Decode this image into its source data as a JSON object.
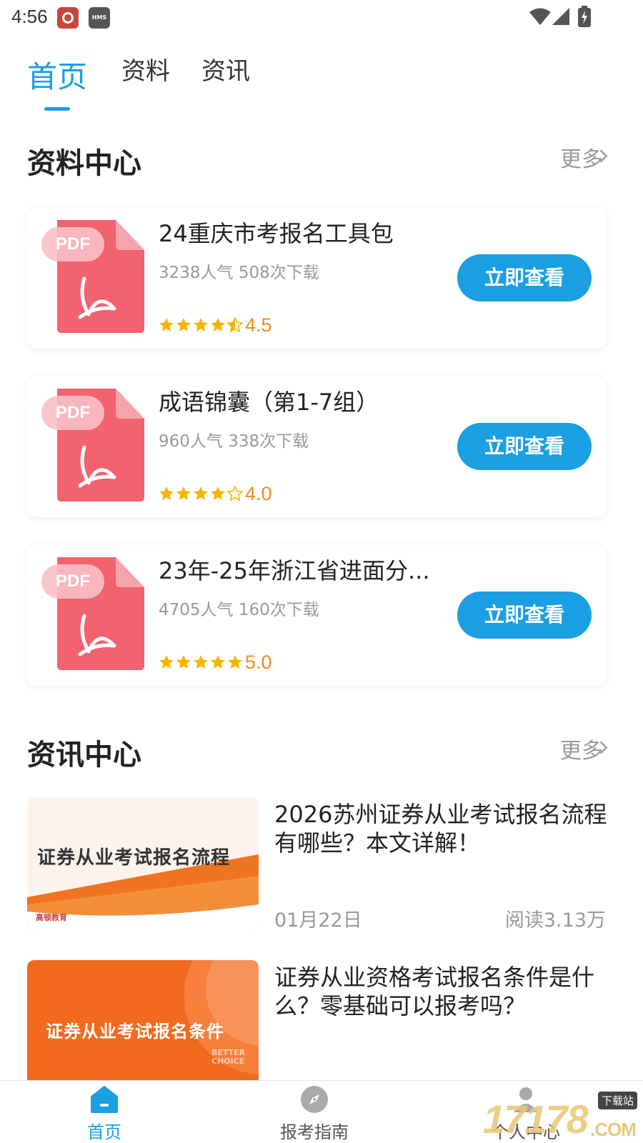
{
  "status_bar": {
    "time": "4:56",
    "app_badge_2": "HMS"
  },
  "top_tabs": [
    {
      "label": "首页",
      "active": true
    },
    {
      "label": "资料",
      "active": false
    },
    {
      "label": "资讯",
      "active": false
    }
  ],
  "resource_center": {
    "title": "资料中心",
    "more_label": "更多",
    "items": [
      {
        "icon_label": "PDF",
        "title": "24重庆市考报名工具包",
        "stats": "3238人气 508次下载",
        "rating": 4.5,
        "rating_text": "4.5",
        "button_label": "立即查看"
      },
      {
        "icon_label": "PDF",
        "title": "成语锦囊（第1-7组）",
        "stats": "960人气 338次下载",
        "rating": 4.0,
        "rating_text": "4.0",
        "button_label": "立即查看"
      },
      {
        "icon_label": "PDF",
        "title": "23年-25年浙江省进面分...",
        "stats": "4705人气 160次下载",
        "rating": 5.0,
        "rating_text": "5.0",
        "button_label": "立即查看"
      }
    ]
  },
  "news_center": {
    "title": "资讯中心",
    "more_label": "更多",
    "items": [
      {
        "thumb_text": "证券从业考试报名流程",
        "thumb_brand": "高顿教育",
        "title": "2026苏州证券从业考试报名流程有哪些？本文详解！",
        "date": "01月22日",
        "reads": "阅读3.13万"
      },
      {
        "thumb_text": "证券从业考试报名条件",
        "thumb_brand": "BETTER CHOICE",
        "title": "证券从业资格考试报名条件是什么？零基础可以报考吗？",
        "date": "",
        "reads": ""
      }
    ]
  },
  "bottom_nav": [
    {
      "label": "首页",
      "icon": "home-icon",
      "active": true
    },
    {
      "label": "报考指南",
      "icon": "compass-icon",
      "active": false
    },
    {
      "label": "个人中心",
      "icon": "person-icon",
      "active": false
    }
  ],
  "watermark": {
    "text": "17178",
    "badge": "下载站",
    "suffix": ".COM"
  },
  "colors": {
    "accent": "#1a9fe3",
    "rating": "#f08a1c",
    "star": "#f5b400",
    "pdf": "#f2626f"
  }
}
